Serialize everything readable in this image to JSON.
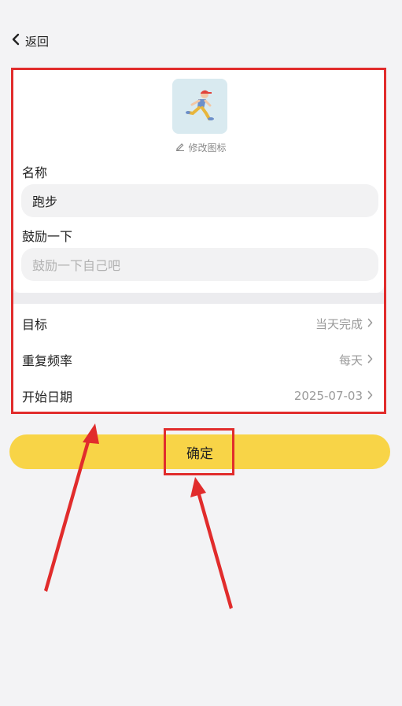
{
  "header": {
    "back_label": "返回"
  },
  "icon_editor": {
    "edit_label": "修改图标",
    "icon": "running-person-icon"
  },
  "form": {
    "name_label": "名称",
    "name_value": "跑步",
    "encourage_label": "鼓励一下",
    "encourage_placeholder": "鼓励一下自己吧"
  },
  "settings": [
    {
      "label": "目标",
      "value": "当天完成"
    },
    {
      "label": "重复频率",
      "value": "每天"
    },
    {
      "label": "开始日期",
      "value": "2025-07-03"
    }
  ],
  "confirm_label": "确定",
  "colors": {
    "accent": "#f8d447",
    "annotation": "#e12c2c"
  }
}
